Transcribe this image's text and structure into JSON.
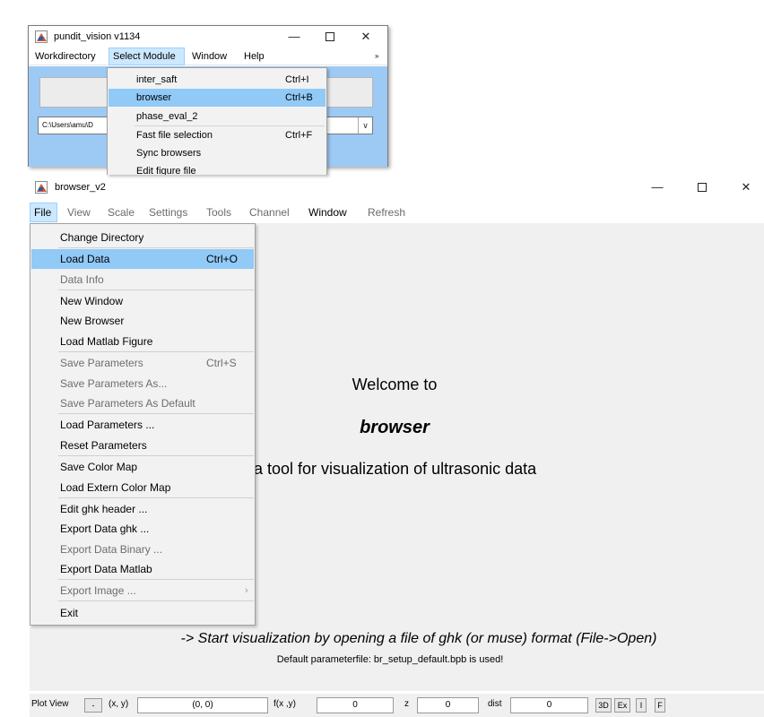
{
  "pundit_window": {
    "title": "pundit_vision v1134",
    "menu": [
      "Workdirectory",
      "Select Module",
      "Window",
      "Help"
    ],
    "path_value": "C:\\Users\\amu\\D",
    "chevron": "»"
  },
  "select_module_menu": {
    "items": [
      {
        "label": "inter_saft",
        "shortcut": "Ctrl+I"
      },
      {
        "label": "browser",
        "shortcut": "Ctrl+B"
      },
      {
        "label": "phase_eval_2",
        "shortcut": ""
      },
      {
        "label": "Fast file selection",
        "shortcut": "Ctrl+F"
      },
      {
        "label": "Sync browsers",
        "shortcut": ""
      },
      {
        "label": "Edit figure file",
        "shortcut": ""
      }
    ]
  },
  "browser_window": {
    "title": "browser_v2",
    "menu": [
      "File",
      "View",
      "Scale",
      "Settings",
      "Tools",
      "Channel",
      "Window",
      "Refresh"
    ]
  },
  "file_menu": {
    "items": [
      {
        "label": "Change Directory",
        "shortcut": ""
      },
      {
        "label": "Load Data",
        "shortcut": "Ctrl+O"
      },
      {
        "label": "Data Info",
        "shortcut": ""
      },
      {
        "label": "New Window",
        "shortcut": ""
      },
      {
        "label": "New  Browser",
        "shortcut": ""
      },
      {
        "label": "Load Matlab Figure",
        "shortcut": ""
      },
      {
        "label": "Save Parameters",
        "shortcut": "Ctrl+S"
      },
      {
        "label": "Save Parameters As...",
        "shortcut": ""
      },
      {
        "label": "Save Parameters As Default",
        "shortcut": ""
      },
      {
        "label": "Load Parameters ...",
        "shortcut": ""
      },
      {
        "label": "Reset Parameters",
        "shortcut": ""
      },
      {
        "label": "Save Color Map",
        "shortcut": ""
      },
      {
        "label": "Load Extern Color Map",
        "shortcut": ""
      },
      {
        "label": "Edit ghk header ...",
        "shortcut": ""
      },
      {
        "label": "Export Data ghk ...",
        "shortcut": ""
      },
      {
        "label": "Export Data Binary ...",
        "shortcut": ""
      },
      {
        "label": "Export Data Matlab",
        "shortcut": ""
      },
      {
        "label": "Export Image ...",
        "shortcut": ""
      },
      {
        "label": "Exit",
        "shortcut": ""
      }
    ]
  },
  "welcome": {
    "line1": "Welcome to",
    "app_name": "browser",
    "description": "a tool for visualization of ultrasonic data",
    "hint": "-> Start visualization by opening a file of ghk (or muse) format (File->Open)",
    "default_file": "Default parameterfile: br_setup_default.bpb is used!"
  },
  "statusbar": {
    "plot_view": "Plot View",
    "minus": "-",
    "xy_label": "(x, y)",
    "xy_value": "(0, 0)",
    "fxy_label": "f(x ,y)",
    "fxy_value": "0",
    "z_label": "z",
    "z_value": "0",
    "dist_label": "dist",
    "dist_value": "0",
    "btn_3d": "3D",
    "btn_ex": "Ex",
    "btn_i": "I",
    "btn_f": "F"
  }
}
